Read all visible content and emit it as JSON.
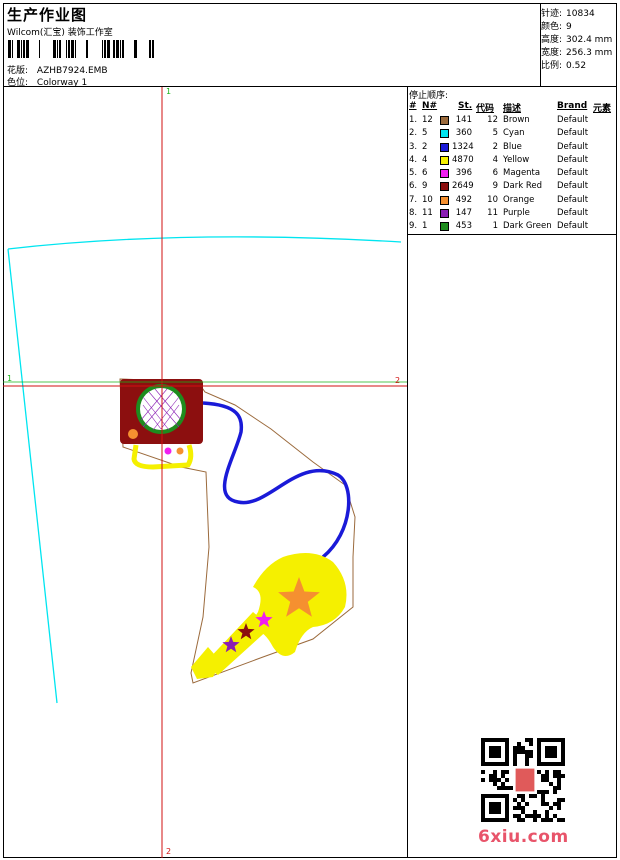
{
  "header": {
    "title": "生产作业图",
    "subtitle": "Wilcom(汇宝) 装饰工作室",
    "design_label": "花版:",
    "design_value": "AZHB7924.EMB",
    "colorway_label": "色位:",
    "colorway_value": "Colorway 1"
  },
  "stats": [
    {
      "label": "针迹:",
      "value": "10834"
    },
    {
      "label": "颜色:",
      "value": "9"
    },
    {
      "label": "高度:",
      "value": "302.4 mm"
    },
    {
      "label": "宽度:",
      "value": "256.3 mm"
    },
    {
      "label": "比例:",
      "value": "0.52"
    }
  ],
  "axis_labels": {
    "top": "1",
    "bottom": "2",
    "left": "1",
    "right": "2"
  },
  "sequence": {
    "heading": "停止顺序:",
    "columns": {
      "index": "#",
      "no": "N#",
      "stitches": "St.",
      "code": "代码",
      "desc": "描述",
      "brand": "Brand",
      "element": "元素"
    },
    "rows": [
      {
        "index": "1.",
        "no": "12",
        "color": "#9b6a3c",
        "stitches": "141",
        "code": "12",
        "desc": "Brown",
        "brand": "Default"
      },
      {
        "index": "2.",
        "no": "5",
        "color": "#00e5f0",
        "stitches": "360",
        "code": "5",
        "desc": "Cyan",
        "brand": "Default"
      },
      {
        "index": "3.",
        "no": "2",
        "color": "#1a1ad8",
        "stitches": "1324",
        "code": "2",
        "desc": "Blue",
        "brand": "Default"
      },
      {
        "index": "4.",
        "no": "4",
        "color": "#f5f000",
        "stitches": "4870",
        "code": "4",
        "desc": "Yellow",
        "brand": "Default"
      },
      {
        "index": "5.",
        "no": "6",
        "color": "#f01ef0",
        "stitches": "396",
        "code": "6",
        "desc": "Magenta",
        "brand": "Default"
      },
      {
        "index": "6.",
        "no": "9",
        "color": "#8c0f0f",
        "stitches": "2649",
        "code": "9",
        "desc": "Dark Red",
        "brand": "Default"
      },
      {
        "index": "7.",
        "no": "10",
        "color": "#f59030",
        "stitches": "492",
        "code": "10",
        "desc": "Orange",
        "brand": "Default"
      },
      {
        "index": "8.",
        "no": "11",
        "color": "#8a1eb4",
        "stitches": "147",
        "code": "11",
        "desc": "Purple",
        "brand": "Default"
      },
      {
        "index": "9.",
        "no": "1",
        "color": "#1e8c1e",
        "stitches": "453",
        "code": "1",
        "desc": "Dark Green",
        "brand": "Default"
      }
    ]
  },
  "watermark": "6xiu.com"
}
